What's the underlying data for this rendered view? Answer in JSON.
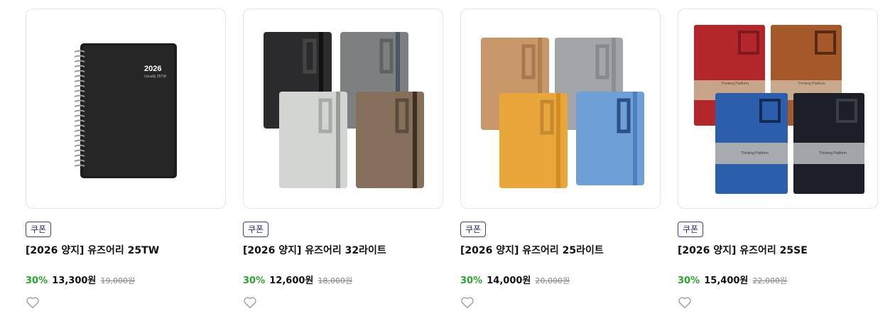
{
  "products": [
    {
      "badge": "쿠폰",
      "title": "[2026 양지] 유즈어리 25TW",
      "discount": "30%",
      "sale_price": "13,300원",
      "original_price": "19,000원",
      "image": {
        "cover_year": "2026",
        "cover_sub": "Usually 25TW"
      }
    },
    {
      "badge": "쿠폰",
      "title": "[2026 양지] 유즈어리 32라이트",
      "discount": "30%",
      "sale_price": "12,600원",
      "original_price": "18,000원"
    },
    {
      "badge": "쿠폰",
      "title": "[2026 양지] 유즈어리 25라이트",
      "discount": "30%",
      "sale_price": "14,000원",
      "original_price": "20,000원"
    },
    {
      "badge": "쿠폰",
      "title": "[2026 양지] 유즈어리 25SE",
      "discount": "30%",
      "sale_price": "15,400원",
      "original_price": "22,000원",
      "image": {
        "band_text": "Thinking Platform"
      }
    }
  ],
  "icons": {
    "wishlist": "heart-outline-icon"
  },
  "colors": {
    "discount": "#2aa52e",
    "badge_border": "#3b3f8a"
  }
}
